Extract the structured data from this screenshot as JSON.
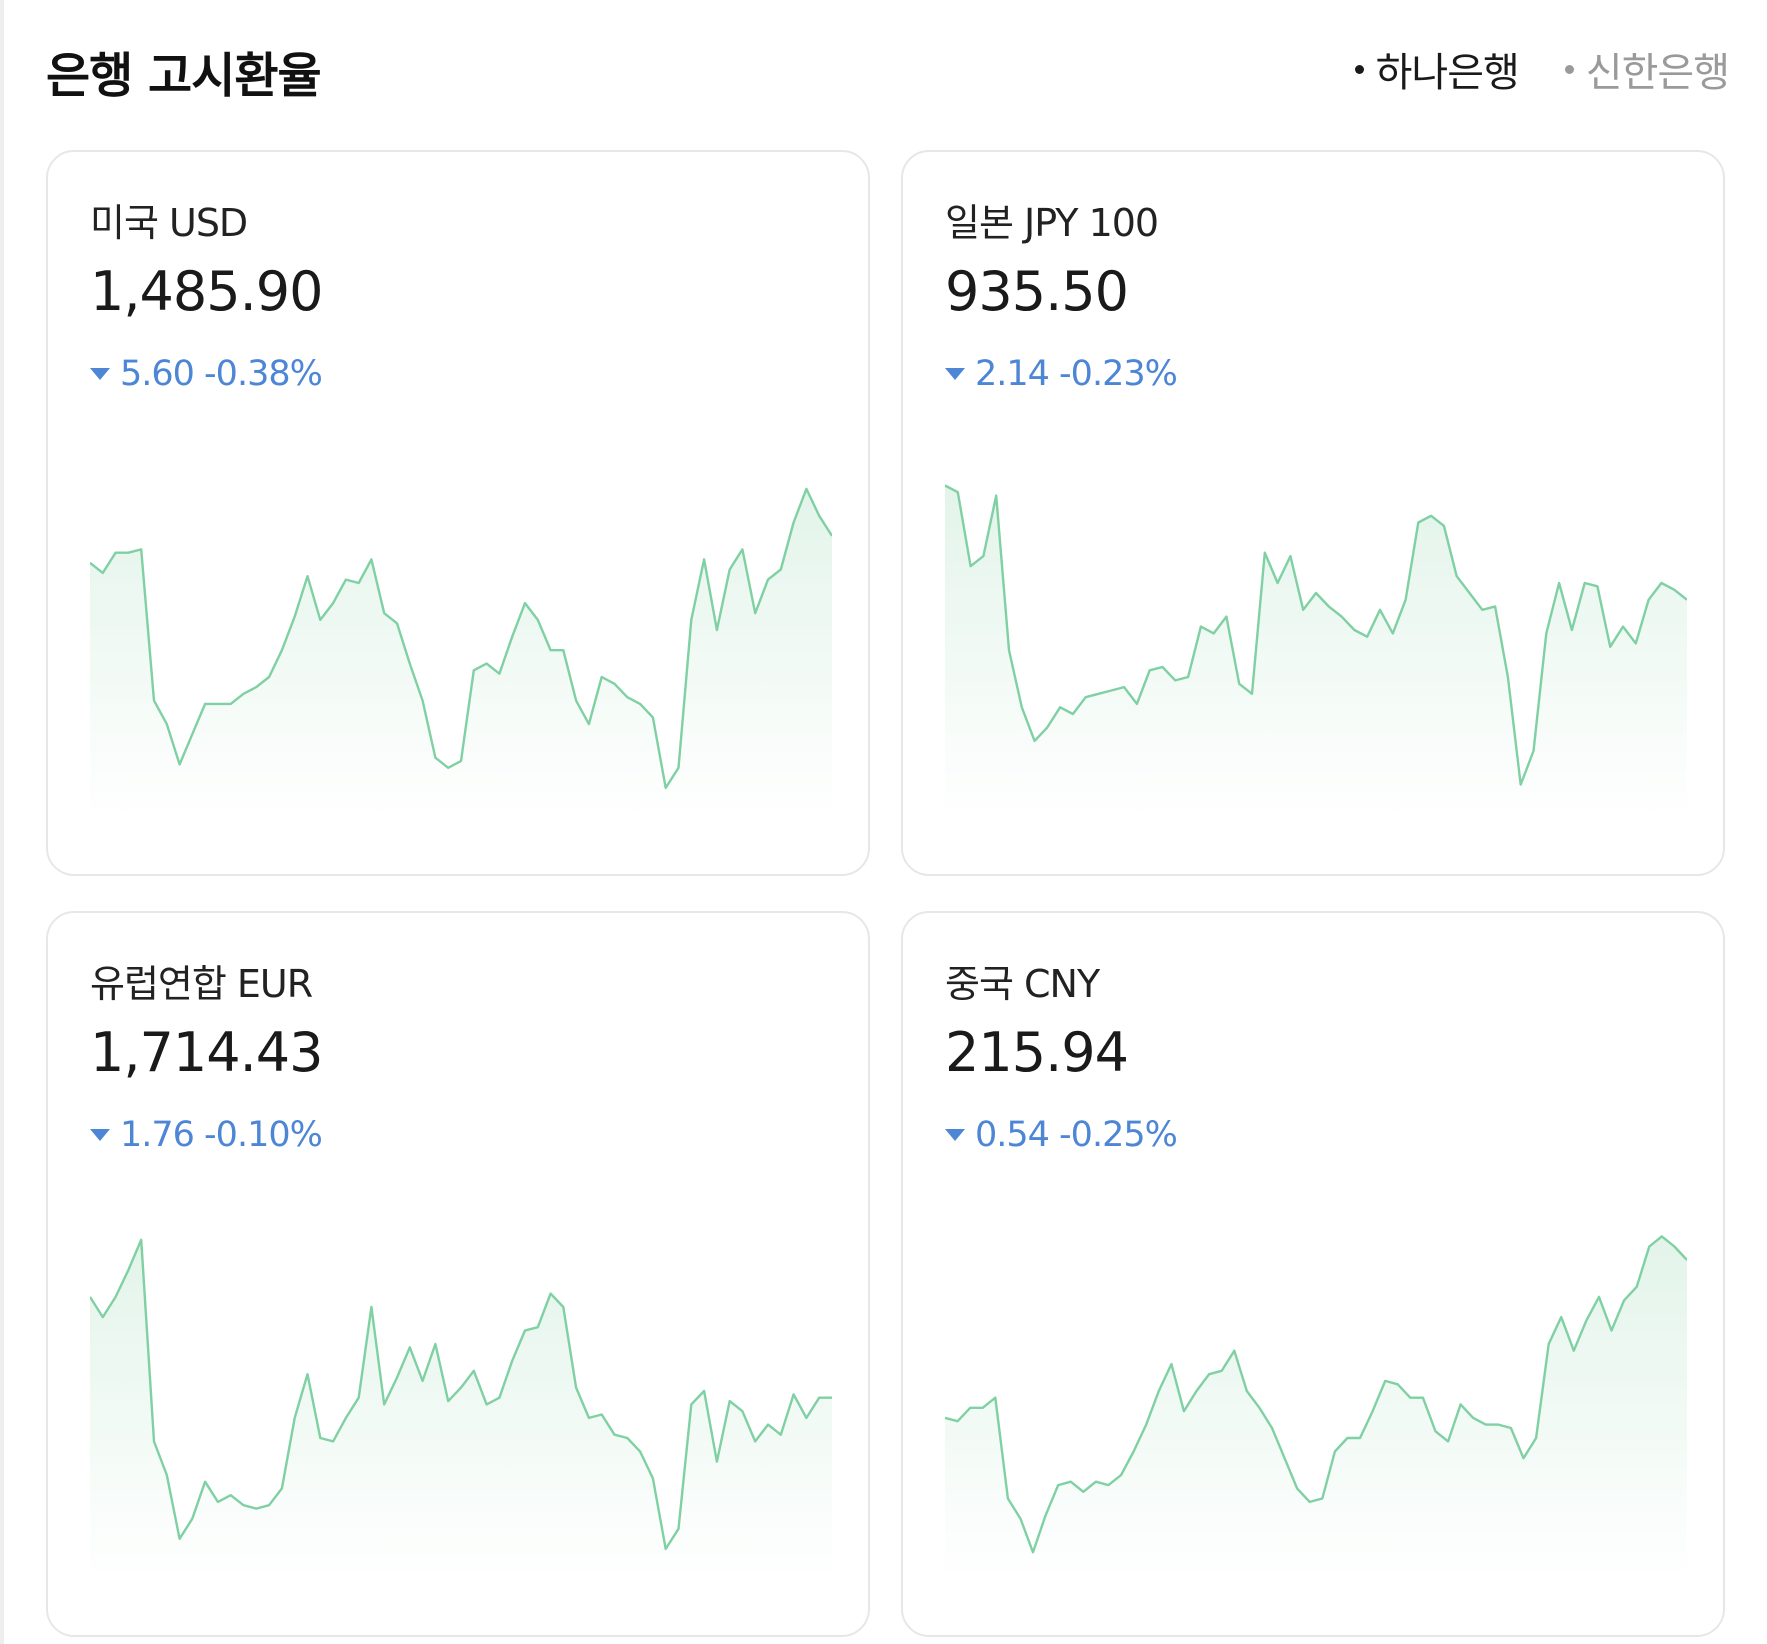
{
  "header": {
    "title": "은행 고시환율",
    "banks": [
      {
        "label": "하나은행",
        "active": true
      },
      {
        "label": "신한은행",
        "active": false
      }
    ]
  },
  "colors": {
    "line": "#7fd0a3",
    "fill": "#e3f4ea",
    "change_down": "#4e86d6",
    "border": "#e7e7e7"
  },
  "cards": [
    {
      "name": "미국 USD",
      "rate": "1,485.90",
      "change": "5.60 -0.38%",
      "direction": "down",
      "icon": "triangle-down-icon",
      "chart_data": {
        "type": "area",
        "values": [
          0.7,
          0.67,
          0.73,
          0.73,
          0.74,
          0.29,
          0.22,
          0.1,
          0.19,
          0.28,
          0.28,
          0.28,
          0.31,
          0.33,
          0.36,
          0.44,
          0.54,
          0.66,
          0.53,
          0.58,
          0.65,
          0.64,
          0.71,
          0.55,
          0.52,
          0.4,
          0.29,
          0.12,
          0.09,
          0.11,
          0.38,
          0.4,
          0.37,
          0.48,
          0.58,
          0.53,
          0.44,
          0.44,
          0.29,
          0.22,
          0.36,
          0.34,
          0.3,
          0.28,
          0.24,
          0.03,
          0.09,
          0.53,
          0.71,
          0.5,
          0.68,
          0.74,
          0.55,
          0.65,
          0.68,
          0.82,
          0.92,
          0.84,
          0.78
        ]
      }
    },
    {
      "name": "일본 JPY 100",
      "rate": "935.50",
      "change": "2.14 -0.23%",
      "direction": "down",
      "icon": "triangle-down-icon",
      "chart_data": {
        "type": "area",
        "values": [
          0.93,
          0.91,
          0.69,
          0.72,
          0.9,
          0.44,
          0.27,
          0.17,
          0.21,
          0.27,
          0.25,
          0.3,
          0.31,
          0.32,
          0.33,
          0.28,
          0.38,
          0.39,
          0.35,
          0.36,
          0.51,
          0.49,
          0.54,
          0.34,
          0.31,
          0.73,
          0.64,
          0.72,
          0.56,
          0.61,
          0.57,
          0.54,
          0.5,
          0.48,
          0.56,
          0.49,
          0.59,
          0.82,
          0.84,
          0.81,
          0.66,
          0.61,
          0.56,
          0.57,
          0.36,
          0.04,
          0.14,
          0.49,
          0.64,
          0.5,
          0.64,
          0.63,
          0.45,
          0.51,
          0.46,
          0.59,
          0.64,
          0.62,
          0.59
        ]
      }
    },
    {
      "name": "유럽연합 EUR",
      "rate": "1,714.43",
      "change": "1.76 -0.10%",
      "direction": "down",
      "icon": "triangle-down-icon",
      "chart_data": {
        "type": "area",
        "values": [
          0.78,
          0.72,
          0.78,
          0.86,
          0.95,
          0.35,
          0.25,
          0.06,
          0.12,
          0.23,
          0.17,
          0.19,
          0.16,
          0.15,
          0.16,
          0.21,
          0.42,
          0.55,
          0.36,
          0.35,
          0.42,
          0.48,
          0.75,
          0.46,
          0.54,
          0.63,
          0.53,
          0.64,
          0.47,
          0.51,
          0.56,
          0.46,
          0.48,
          0.59,
          0.68,
          0.69,
          0.79,
          0.75,
          0.51,
          0.42,
          0.43,
          0.37,
          0.36,
          0.32,
          0.24,
          0.03,
          0.09,
          0.46,
          0.5,
          0.29,
          0.47,
          0.44,
          0.35,
          0.4,
          0.37,
          0.49,
          0.42,
          0.48,
          0.48
        ]
      }
    },
    {
      "name": "중국 CNY",
      "rate": "215.94",
      "change": "0.54 -0.25%",
      "direction": "down",
      "icon": "triangle-down-icon",
      "chart_data": {
        "type": "area",
        "values": [
          0.42,
          0.41,
          0.45,
          0.45,
          0.48,
          0.18,
          0.12,
          0.02,
          0.13,
          0.22,
          0.23,
          0.2,
          0.23,
          0.22,
          0.25,
          0.32,
          0.4,
          0.5,
          0.58,
          0.44,
          0.5,
          0.55,
          0.56,
          0.62,
          0.5,
          0.45,
          0.39,
          0.3,
          0.21,
          0.17,
          0.18,
          0.32,
          0.36,
          0.36,
          0.44,
          0.53,
          0.52,
          0.48,
          0.48,
          0.38,
          0.35,
          0.46,
          0.42,
          0.4,
          0.4,
          0.39,
          0.3,
          0.36,
          0.64,
          0.72,
          0.62,
          0.71,
          0.78,
          0.68,
          0.77,
          0.81,
          0.93,
          0.96,
          0.93,
          0.89
        ]
      }
    }
  ]
}
